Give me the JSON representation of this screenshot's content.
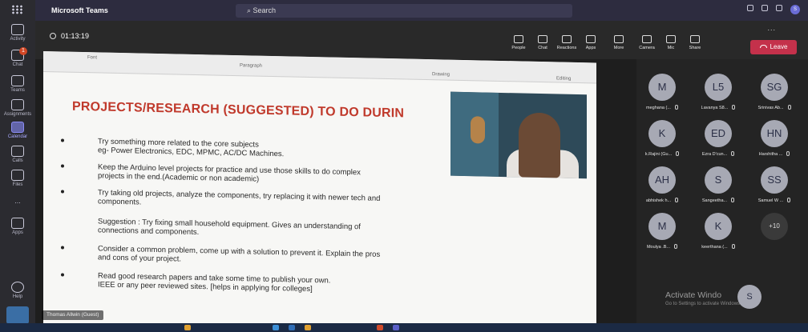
{
  "window": {
    "app_name": "Microsoft Teams",
    "search_placeholder": "Search"
  },
  "rail": {
    "items": [
      {
        "label": "Activity"
      },
      {
        "label": "Chat",
        "badge": "1"
      },
      {
        "label": "Teams"
      },
      {
        "label": "Assignments"
      },
      {
        "label": "Calendar"
      },
      {
        "label": "Calls"
      },
      {
        "label": "Files"
      },
      {
        "label": "..."
      },
      {
        "label": "Apps"
      },
      {
        "label": "Help"
      }
    ]
  },
  "meeting": {
    "timer": "01:13:19",
    "tools": [
      "People",
      "Chat",
      "Reactions",
      "Apps",
      "More",
      "Camera",
      "Mic",
      "Share"
    ],
    "leave_label": "Leave",
    "more_dots": "..."
  },
  "slide": {
    "ribbon": [
      "Font",
      "Paragraph",
      "Drawing",
      "Editing"
    ],
    "title": "PROJECTS/RESEARCH (SUGGESTED) TO DO DURIN",
    "bullets": [
      {
        "text": "Try something more related to the core subjects",
        "text2": "eg- Power Electronics, EDC, MPMC, AC/DC Machines.",
        "dot": true
      },
      {
        "text": "Keep the Arduino level projects for practice and use those skills to do complex",
        "text2": "projects in the end.(Academic or non academic)",
        "dot": true
      },
      {
        "text": "Try taking old projects, analyze the components, try replacing it with newer tech and",
        "text2": "components.",
        "dot": true
      },
      {
        "text": "Suggestion : Try fixing small household equipment. Gives an understanding of",
        "text2": "connections and components.",
        "dot": false
      },
      {
        "text": "Consider a common problem, come up with a solution to prevent it. Explain the pros",
        "text2": "and cons of your project.",
        "dot": true
      },
      {
        "text": "Read good research papers and take some time to publish your own.",
        "text2": "IEEE or any peer reviewed sites. [helps in applying for colleges]",
        "dot": true
      }
    ],
    "presenter": "Thomas Allwin (Guest)"
  },
  "participants": [
    {
      "initials": "M",
      "name": "meghana (..."
    },
    {
      "initials": "L5",
      "name": "Lavanya S8..."
    },
    {
      "initials": "SG",
      "name": "Srinivas Ab..."
    },
    {
      "initials": "K",
      "name": "k.Rajini (Gu..."
    },
    {
      "initials": "ED",
      "name": "Ezra D'cun..."
    },
    {
      "initials": "HN",
      "name": "Harshitha ..."
    },
    {
      "initials": "AH",
      "name": "abhishek h..."
    },
    {
      "initials": "S",
      "name": "Sangeetha..."
    },
    {
      "initials": "SS",
      "name": "Samuel W ..."
    },
    {
      "initials": "M",
      "name": "Moulya .B..."
    },
    {
      "initials": "K",
      "name": "keerthana (..."
    },
    {
      "initials": "+10",
      "name": ""
    }
  ],
  "self_initials": "S",
  "watermark": {
    "title": "Activate Windo",
    "sub": "Go to Settings to activate Windows"
  }
}
